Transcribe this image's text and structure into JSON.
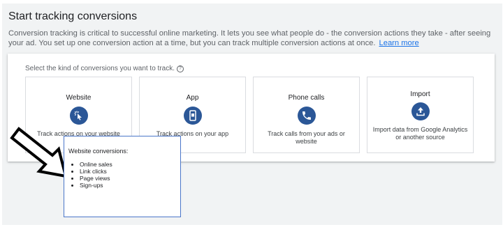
{
  "header": {
    "title": "Start tracking conversions",
    "description": "Conversion tracking is critical to successful online marketing. It lets you see what people do - the conversion actions they take - after seeing your ad. You set up one conversion action at a time, but you can track multiple conversion actions at once.",
    "learn_more": "Learn more"
  },
  "selector": {
    "prompt": "Select the kind of conversions you want to track.",
    "help_glyph": "?",
    "tiles": [
      {
        "title": "Website",
        "description": "Track actions on your website",
        "icon": "cursor-click-icon"
      },
      {
        "title": "App",
        "description": "Track actions on your app",
        "icon": "smartphone-icon"
      },
      {
        "title": "Phone calls",
        "description": "Track calls from your ads or website",
        "icon": "phone-icon"
      },
      {
        "title": "Import",
        "description": "Import data from Google Analytics or another source",
        "icon": "upload-icon"
      }
    ]
  },
  "popup": {
    "title": "Website conversions:",
    "items": [
      "Online sales",
      "Link clicks",
      "Page views",
      "Sign-ups"
    ]
  },
  "colors": {
    "icon_circle": "#2b5797",
    "link": "#1a73e8",
    "popup_border": "#4a76c9"
  }
}
